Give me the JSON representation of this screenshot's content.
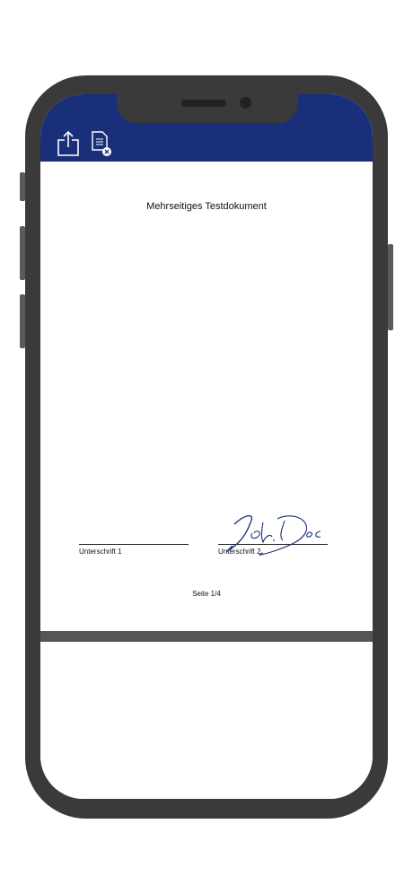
{
  "toolbar": {
    "background": "#1a2f7a",
    "icons": [
      "share-icon",
      "document-close-icon"
    ]
  },
  "document": {
    "title": "Mehrseitiges Testdokument",
    "signature_1_label": "Unterschrift 1",
    "signature_2_label": "Unterschrift 2",
    "page_indicator": "Seite 1/4"
  },
  "signature": {
    "color": "#1a2f7a"
  }
}
